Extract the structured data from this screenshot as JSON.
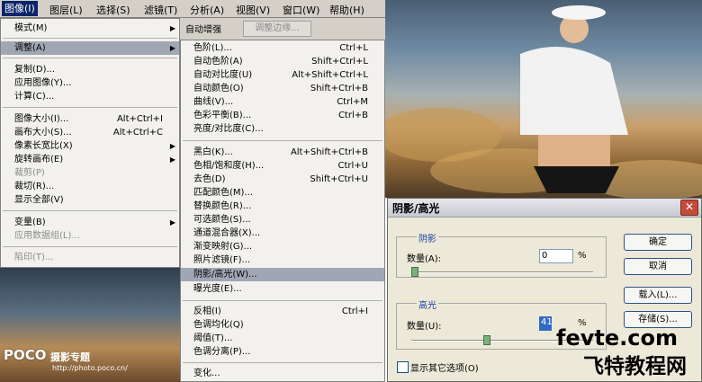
{
  "menubar": {
    "items": [
      "图像(I)",
      "图层(L)",
      "选择(S)",
      "滤镜(T)",
      "分析(A)",
      "视图(V)",
      "窗口(W)",
      "帮助(H)"
    ]
  },
  "optbar": {
    "auto_label": "自动增强",
    "edge_label": "调整边缘..."
  },
  "menu1": {
    "items": [
      {
        "label": "模式(M)",
        "shortcut": "",
        "arrow": "▶",
        "disabled": false
      },
      {
        "label": "调整(A)",
        "shortcut": "",
        "arrow": "▶",
        "disabled": false
      },
      {
        "label": "复制(D)...",
        "shortcut": "",
        "arrow": "",
        "disabled": false
      },
      {
        "label": "应用图像(Y)...",
        "shortcut": "",
        "arrow": "",
        "disabled": false
      },
      {
        "label": "计算(C)...",
        "shortcut": "",
        "arrow": "",
        "disabled": false
      },
      {
        "label": "图像大小(I)...",
        "shortcut": "Alt+Ctrl+I",
        "arrow": "",
        "disabled": false
      },
      {
        "label": "画布大小(S)...",
        "shortcut": "Alt+Ctrl+C",
        "arrow": "",
        "disabled": false
      },
      {
        "label": "像素长宽比(X)",
        "shortcut": "",
        "arrow": "▶",
        "disabled": false
      },
      {
        "label": "旋转画布(E)",
        "shortcut": "",
        "arrow": "▶",
        "disabled": false
      },
      {
        "label": "裁剪(P)",
        "shortcut": "",
        "arrow": "",
        "disabled": true
      },
      {
        "label": "裁切(R)...",
        "shortcut": "",
        "arrow": "",
        "disabled": false
      },
      {
        "label": "显示全部(V)",
        "shortcut": "",
        "arrow": "",
        "disabled": false
      },
      {
        "label": "变量(B)",
        "shortcut": "",
        "arrow": "▶",
        "disabled": false
      },
      {
        "label": "应用数据组(L)...",
        "shortcut": "",
        "arrow": "",
        "disabled": true
      },
      {
        "label": "陷印(T)...",
        "shortcut": "",
        "arrow": "",
        "disabled": true
      }
    ]
  },
  "menu2": {
    "items": [
      {
        "label": "色阶(L)...",
        "shortcut": "Ctrl+L"
      },
      {
        "label": "自动色阶(A)",
        "shortcut": "Shift+Ctrl+L"
      },
      {
        "label": "自动对比度(U)",
        "shortcut": "Alt+Shift+Ctrl+L"
      },
      {
        "label": "自动颜色(O)",
        "shortcut": "Shift+Ctrl+B"
      },
      {
        "label": "曲线(V)...",
        "shortcut": "Ctrl+M"
      },
      {
        "label": "色彩平衡(B)...",
        "shortcut": "Ctrl+B"
      },
      {
        "label": "亮度/对比度(C)...",
        "shortcut": ""
      },
      {
        "label": "黑白(K)...",
        "shortcut": "Alt+Shift+Ctrl+B"
      },
      {
        "label": "色相/饱和度(H)...",
        "shortcut": "Ctrl+U"
      },
      {
        "label": "去色(D)",
        "shortcut": "Shift+Ctrl+U"
      },
      {
        "label": "匹配颜色(M)...",
        "shortcut": ""
      },
      {
        "label": "替换颜色(R)...",
        "shortcut": ""
      },
      {
        "label": "可选颜色(S)...",
        "shortcut": ""
      },
      {
        "label": "通道混合器(X)...",
        "shortcut": ""
      },
      {
        "label": "渐变映射(G)...",
        "shortcut": ""
      },
      {
        "label": "照片滤镜(F)...",
        "shortcut": ""
      },
      {
        "label": "阴影/高光(W)...",
        "shortcut": ""
      },
      {
        "label": "曝光度(E)...",
        "shortcut": ""
      },
      {
        "label": "反相(I)",
        "shortcut": "Ctrl+I"
      },
      {
        "label": "色调均化(Q)",
        "shortcut": ""
      },
      {
        "label": "阈值(T)...",
        "shortcut": ""
      },
      {
        "label": "色调分离(P)...",
        "shortcut": ""
      },
      {
        "label": "变化...",
        "shortcut": ""
      }
    ]
  },
  "dialog": {
    "title": "阴影/高光",
    "close": "✕",
    "shadow": {
      "group": "阴影",
      "amount_label": "数量(A):",
      "value": "0",
      "unit": "%",
      "level": 0
    },
    "highlight": {
      "group": "高光",
      "amount_label": "数量(U):",
      "value": "41",
      "unit": "%",
      "level": 0.41
    },
    "buttons": {
      "ok": "确定",
      "cancel": "取消",
      "load": "载入(L)...",
      "save": "存储(S)..."
    },
    "more_options": "显示其它选项(O)"
  },
  "watermarks": {
    "poco": "POCO",
    "poco_topic": "摄影专题",
    "poco_url": "http://photo.poco.cn/",
    "site": "fevte.com",
    "site_cn": "飞特教程网"
  },
  "colors": {
    "menu_highlight": "#a0a7b4",
    "active_menu": "#0a246a",
    "group_label": "#1a3e9e"
  }
}
